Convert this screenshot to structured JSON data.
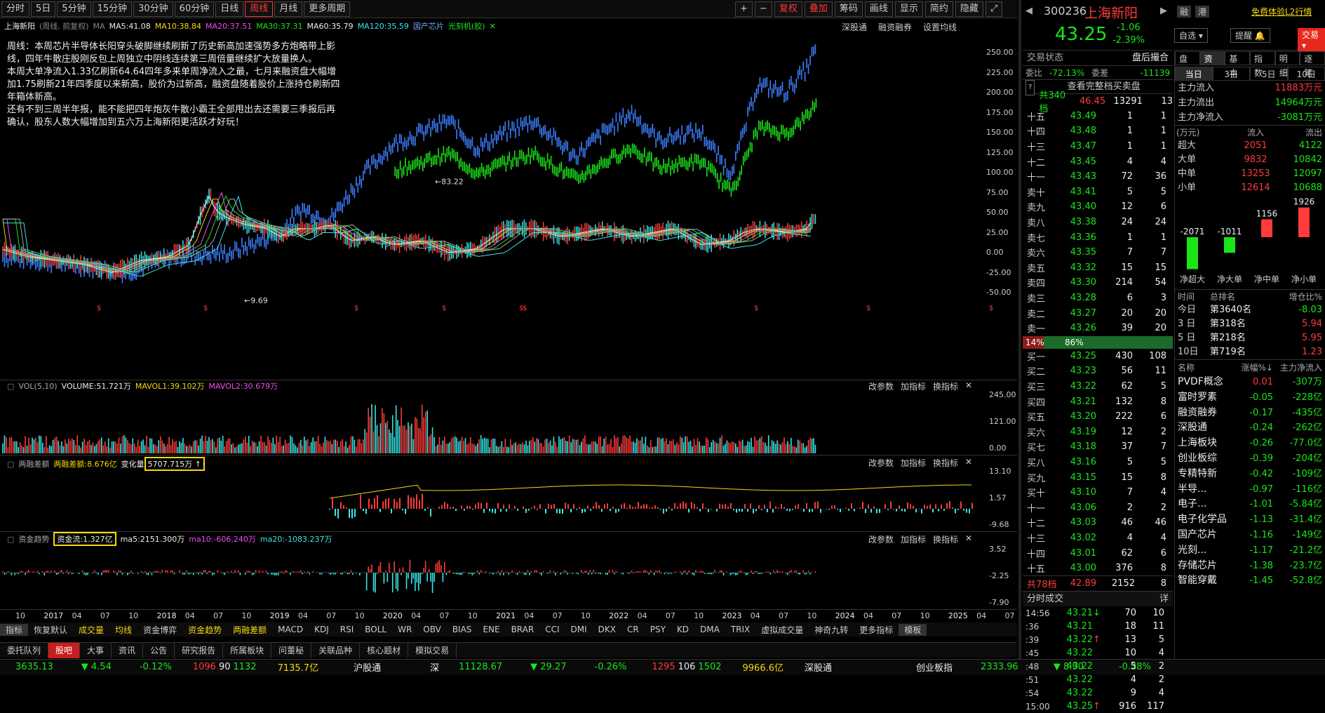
{
  "toolbar": {
    "periods": [
      "分时",
      "5日",
      "5分钟",
      "15分钟",
      "30分钟",
      "60分钟",
      "日线",
      "周线",
      "月线",
      "更多周期"
    ],
    "active_period": "周线",
    "right_buttons": [
      "复权",
      "叠加",
      "筹码",
      "画线",
      "显示",
      "简约",
      "隐藏"
    ]
  },
  "chart_info": {
    "name": "上海新阳",
    "mode": "(周线, 前复权)",
    "ma_label": "MA",
    "ma5": "MA5:41.08",
    "ma10": "MA10:38.84",
    "ma20": "MA20:37.51",
    "ma30": "MA30:37.31",
    "ma60": "MA60:35.79",
    "ma120": "MA120:35.59",
    "tag1": "国产芯片",
    "tag2": "光刻机(胶)",
    "right_links": [
      "深股通",
      "融资融券",
      "设置均线"
    ]
  },
  "annotation": [
    "周线：本周芯片半导体长阳穿头破脚继续刷新了历史新高加速强势多方炮略带上影",
    "线，四年牛散庄股刚反包上周独立中阴线连续第三周倍量继续扩大放量换人。",
    "本周大单净流入1.33亿刷新64.64四年多来单周净流入之最，七月来融资盘大幅增",
    "加1.75刷新21年四季度以来新高，股价为过新高，融资盘随着股价上涨持仓刷新四",
    "年箱体新高。",
    "还有不到三周半年报，能不能把四年炮灰牛散小霸王全部甩出去还需要三季报后再",
    "确认，股东人数大幅增加到五六万上海新阳更活跃才好玩！"
  ],
  "price_axis": [
    "250.00",
    "225.00",
    "200.00",
    "175.00",
    "150.00",
    "125.00",
    "100.00",
    "75.00",
    "50.00",
    "25.00",
    "0.00",
    "-25.00",
    "-50.00"
  ],
  "peak_label": "83.22",
  "low_label": "9.69",
  "vol": {
    "title": "VOL(5,10)",
    "volume": "VOLUME:51.721万",
    "mavol1": "MAVOL1:39.102万",
    "mavol2": "MAVOL2:30.679万",
    "axis": [
      "245.00",
      "121.00",
      "0.00"
    ]
  },
  "margin": {
    "title": "两融差额",
    "val": "两融差额:8.676亿",
    "chg_label": "变化量",
    "chg": "5707.715万 ↑",
    "axis": [
      "13.10",
      "1.57",
      "-9.68"
    ]
  },
  "fund": {
    "title": "资金趋势",
    "val": "资金流:1.327亿",
    "ma5": "ma5:2151.300万",
    "ma10": "ma10:-606.240万",
    "ma20": "ma20:-1083.237万",
    "axis": [
      "3.52",
      "-2.25",
      "-7.90"
    ]
  },
  "panel_buttons": [
    "改参数",
    "加指标",
    "换指标"
  ],
  "time_axis": [
    "10",
    "2017",
    "04",
    "07",
    "10",
    "2018",
    "04",
    "07",
    "10",
    "2019",
    "04",
    "07",
    "10",
    "2020",
    "04",
    "07",
    "10",
    "2021",
    "04",
    "07",
    "10",
    "2022",
    "04",
    "07",
    "10",
    "2023",
    "04",
    "07",
    "10",
    "2024",
    "04",
    "07",
    "10",
    "2025",
    "04",
    "07"
  ],
  "indicator_tabs": [
    "指标",
    "恢复默认",
    "成交量",
    "均线",
    "资金博弈",
    "资金趋势",
    "两融差额",
    "MACD",
    "KDJ",
    "RSI",
    "BOLL",
    "WR",
    "OBV",
    "BIAS",
    "ENE",
    "BRAR",
    "CCI",
    "DMI",
    "DKX",
    "CR",
    "PSY",
    "KD",
    "DMA",
    "TRIX",
    "虚拟成交量",
    "神奇九转",
    "更多指标",
    "模板"
  ],
  "bottom_tabs": [
    "委托队列",
    "股吧",
    "大事",
    "资讯",
    "公告",
    "研究报告",
    "所属板块",
    "问董秘",
    "关联品种",
    "核心题材",
    "模拟交易"
  ],
  "stock": {
    "code": "300236",
    "name": "上海新阳",
    "btn1": "融",
    "btn2": "港",
    "l2": "免费体验L2行情",
    "price": "43.25",
    "chg": "-1.06",
    "pct": "-2.39%",
    "watch": "自选",
    "remind": "提醒",
    "trade": "交易"
  },
  "trade_status": {
    "label": "交易状态",
    "value": "盘后撮合"
  },
  "weibi": {
    "label": "委比",
    "value": "-72.13%",
    "label2": "委差",
    "value2": "-11139"
  },
  "orderbook_link": "查看完整档买卖盘",
  "sell_total": {
    "label": "共340档",
    "price": "46.45",
    "vol": "13291",
    "n": "13"
  },
  "sells": [
    {
      "l": "十五",
      "p": "43.49",
      "v": "1",
      "n": "1"
    },
    {
      "l": "十四",
      "p": "43.48",
      "v": "1",
      "n": "1"
    },
    {
      "l": "十三",
      "p": "43.47",
      "v": "1",
      "n": "1"
    },
    {
      "l": "十二",
      "p": "43.45",
      "v": "4",
      "n": "4"
    },
    {
      "l": "十一",
      "p": "43.43",
      "v": "72",
      "n": "36"
    },
    {
      "l": "卖十",
      "p": "43.41",
      "v": "5",
      "n": "5"
    },
    {
      "l": "卖九",
      "p": "43.40",
      "v": "12",
      "n": "6"
    },
    {
      "l": "卖八",
      "p": "43.38",
      "v": "24",
      "n": "24"
    },
    {
      "l": "卖七",
      "p": "43.36",
      "v": "1",
      "n": "1"
    },
    {
      "l": "卖六",
      "p": "43.35",
      "v": "7",
      "n": "7"
    },
    {
      "l": "卖五",
      "p": "43.32",
      "v": "15",
      "n": "15"
    },
    {
      "l": "卖四",
      "p": "43.30",
      "v": "214",
      "n": "54"
    },
    {
      "l": "卖三",
      "p": "43.28",
      "v": "6",
      "n": "3"
    },
    {
      "l": "卖二",
      "p": "43.27",
      "v": "20",
      "n": "20"
    },
    {
      "l": "卖一",
      "p": "43.26",
      "v": "39",
      "n": "20"
    }
  ],
  "ratio": {
    "buy": "14%",
    "sell": "86%",
    "buy_frac": 0.14
  },
  "buys": [
    {
      "l": "买一",
      "p": "43.25",
      "v": "430",
      "n": "108"
    },
    {
      "l": "买二",
      "p": "43.23",
      "v": "56",
      "n": "11"
    },
    {
      "l": "买三",
      "p": "43.22",
      "v": "62",
      "n": "5"
    },
    {
      "l": "买四",
      "p": "43.21",
      "v": "132",
      "n": "8"
    },
    {
      "l": "买五",
      "p": "43.20",
      "v": "222",
      "n": "6"
    },
    {
      "l": "买六",
      "p": "43.19",
      "v": "12",
      "n": "2"
    },
    {
      "l": "买七",
      "p": "43.18",
      "v": "37",
      "n": "7"
    },
    {
      "l": "买八",
      "p": "43.16",
      "v": "5",
      "n": "5"
    },
    {
      "l": "买九",
      "p": "43.15",
      "v": "15",
      "n": "8"
    },
    {
      "l": "买十",
      "p": "43.10",
      "v": "7",
      "n": "4"
    },
    {
      "l": "十一",
      "p": "43.06",
      "v": "2",
      "n": "2"
    },
    {
      "l": "十二",
      "p": "43.03",
      "v": "46",
      "n": "46"
    },
    {
      "l": "十三",
      "p": "43.02",
      "v": "4",
      "n": "4"
    },
    {
      "l": "十四",
      "p": "43.01",
      "v": "62",
      "n": "6"
    },
    {
      "l": "十五",
      "p": "43.00",
      "v": "376",
      "n": "8"
    }
  ],
  "buy_total": {
    "label": "共78档",
    "price": "42.89",
    "vol": "2152",
    "n": "8"
  },
  "ticks_title": "分时成交",
  "ticks_btn": "详",
  "ticks": [
    {
      "t": "14:56",
      "p": "43.21",
      "a": "↓",
      "v": "70",
      "n": "10"
    },
    {
      "t": ":36",
      "p": "43.21",
      "a": "",
      "v": "18",
      "n": "11"
    },
    {
      "t": ":39",
      "p": "43.22",
      "a": "↑",
      "v": "13",
      "n": "5"
    },
    {
      "t": ":45",
      "p": "43.22",
      "a": "",
      "v": "10",
      "n": "4"
    },
    {
      "t": ":48",
      "p": "43.22",
      "a": "",
      "v": "5",
      "n": "2"
    },
    {
      "t": ":51",
      "p": "43.22",
      "a": "",
      "v": "4",
      "n": "2"
    },
    {
      "t": ":54",
      "p": "43.22",
      "a": "",
      "v": "9",
      "n": "4"
    },
    {
      "t": "15:00",
      "p": "43.25",
      "a": "↑",
      "v": "916",
      "n": "117"
    }
  ],
  "fund_tabs": [
    "盘口",
    "资金",
    "基本",
    "指数",
    "明细",
    "逐笔"
  ],
  "day_tabs": [
    "当日",
    "3日",
    "5日",
    "10日"
  ],
  "main_flow": [
    {
      "l": "主力流入",
      "v": "11883万元"
    },
    {
      "l": "主力流出",
      "v": "14964万元"
    },
    {
      "l": "主力净流入",
      "v": "-3081万元"
    }
  ],
  "flow_header": {
    "unit": "(万元)",
    "in": "流入",
    "out": "流出"
  },
  "flow_rows": [
    {
      "l": "超大",
      "in": "2051",
      "out": "4122"
    },
    {
      "l": "大单",
      "in": "9832",
      "out": "10842"
    },
    {
      "l": "中单",
      "in": "13253",
      "out": "12097"
    },
    {
      "l": "小单",
      "in": "12614",
      "out": "10688"
    }
  ],
  "net_bars": [
    {
      "label": "净超大",
      "value": -2071,
      "text": "-2071"
    },
    {
      "label": "净大单",
      "value": -1011,
      "text": "-1011"
    },
    {
      "label": "净中单",
      "value": 1156,
      "text": "1156"
    },
    {
      "label": "净小单",
      "value": 1926,
      "text": "1926"
    }
  ],
  "rank_header": {
    "t": "时间",
    "r": "总排名",
    "p": "增仓比%"
  },
  "ranks": [
    {
      "t": "今日",
      "r": "第3640名",
      "p": "-8.03"
    },
    {
      "t": "3 日",
      "r": "第318名",
      "p": "5.94"
    },
    {
      "t": "5 日",
      "r": "第218名",
      "p": "5.95"
    },
    {
      "t": "10日",
      "r": "第719名",
      "p": "1.23"
    }
  ],
  "sector_header": {
    "n": "名称",
    "c": "涨幅%↓",
    "f": "主力净流入"
  },
  "sectors": [
    {
      "n": "PVDF概念",
      "c": "0.01",
      "f": "-307万"
    },
    {
      "n": "富时罗素",
      "c": "-0.05",
      "f": "-228亿"
    },
    {
      "n": "融资融券",
      "c": "-0.17",
      "f": "-435亿"
    },
    {
      "n": "深股通",
      "c": "-0.24",
      "f": "-262亿"
    },
    {
      "n": "上海板块",
      "c": "-0.26",
      "f": "-77.0亿"
    },
    {
      "n": "创业板综",
      "c": "-0.39",
      "f": "-204亿"
    },
    {
      "n": "专精特新",
      "c": "-0.42",
      "f": "-109亿"
    },
    {
      "n": "半导...",
      "c": "-0.97",
      "f": "-116亿"
    },
    {
      "n": "电子...",
      "c": "-1.01",
      "f": "-5.84亿"
    },
    {
      "n": "电子化学品",
      "c": "-1.13",
      "f": "-31.4亿"
    },
    {
      "n": "国产芯片",
      "c": "-1.16",
      "f": "-149亿"
    },
    {
      "n": "光刻...",
      "c": "-1.17",
      "f": "-21.2亿"
    },
    {
      "n": "存储芯片",
      "c": "-1.38",
      "f": "-23.7亿"
    },
    {
      "n": "智能穿戴",
      "c": "-1.45",
      "f": "-52.8亿"
    }
  ],
  "status_bar": {
    "sh": "3635.13",
    "sh_chg": "▼ 4.54",
    "sh_pct": "-0.12%",
    "sh_up": "1096",
    "sh_flat": "90",
    "sh_dn": "1132",
    "sh_amt": "7135.7亿",
    "hgt": "沪股通",
    "sz_label": "深",
    "sz": "11128.67",
    "sz_chg": "▼ 29.27",
    "sz_pct": "-0.26%",
    "sz_up": "1295",
    "sz_flat": "106",
    "sz_dn": "1502",
    "sz_amt": "9966.6亿",
    "sgt": "深股通",
    "cyb_label": "创业板指",
    "cyb": "2333.96",
    "cyb_chg": "▼ 8.90",
    "cyb_pct": "-0.38%"
  },
  "colors": {
    "red": "#ff3b3b",
    "green": "#19e619",
    "cyan": "#38e6e6",
    "yellow": "#f5d80c",
    "magenta": "#f04af0",
    "blue": "#3d7fff"
  }
}
